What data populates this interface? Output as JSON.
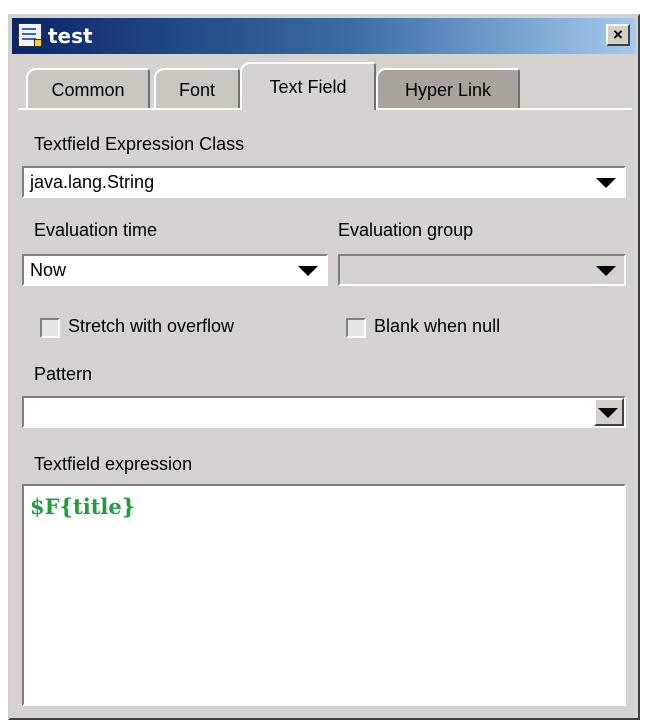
{
  "window": {
    "title": "test",
    "close_glyph": "×"
  },
  "tabs": [
    {
      "label": "Common",
      "active": false
    },
    {
      "label": "Font",
      "active": false
    },
    {
      "label": "Text Field",
      "active": true
    },
    {
      "label": "Hyper Link",
      "active": false
    }
  ],
  "expression_class": {
    "label": "Textfield Expression Class",
    "value": "java.lang.String"
  },
  "evaluation_time": {
    "label": "Evaluation time",
    "value": "Now"
  },
  "evaluation_group": {
    "label": "Evaluation group",
    "value": ""
  },
  "stretch_with_overflow": {
    "label": "Stretch with overflow",
    "checked": false
  },
  "blank_when_null": {
    "label": "Blank when null",
    "checked": false
  },
  "pattern": {
    "label": "Pattern",
    "value": ""
  },
  "textfield_expression": {
    "label": "Textfield expression",
    "value": "$F{title}"
  },
  "colors": {
    "expression_text": "#1e9e3a",
    "titlebar_start": "#0a246a"
  }
}
